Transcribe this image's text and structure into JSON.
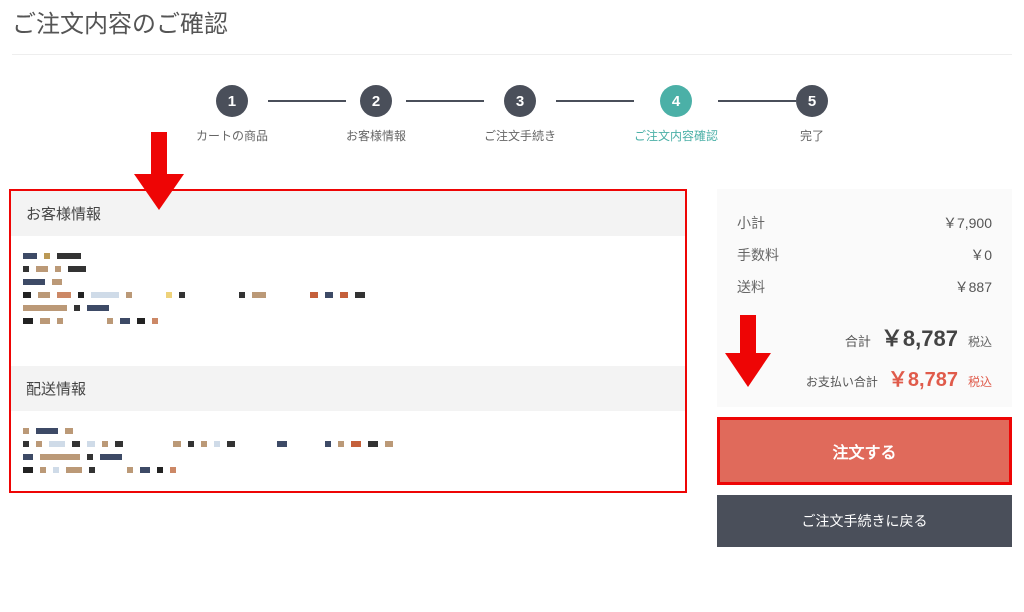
{
  "page_title": "ご注文内容のご確認",
  "stepper": [
    {
      "num": "1",
      "label": "カートの商品",
      "active": false
    },
    {
      "num": "2",
      "label": "お客様情報",
      "active": false
    },
    {
      "num": "3",
      "label": "ご注文手続き",
      "active": false
    },
    {
      "num": "4",
      "label": "ご注文内容確認",
      "active": true
    },
    {
      "num": "5",
      "label": "完了",
      "active": false
    }
  ],
  "sections": {
    "customer_heading": "お客様情報",
    "shipping_heading": "配送情報"
  },
  "summary": {
    "subtotal_label": "小計",
    "subtotal_value": "￥7,900",
    "fee_label": "手数料",
    "fee_value": "￥0",
    "shipping_label": "送料",
    "shipping_value": "￥887",
    "total_label": "合計",
    "total_value": "￥8,787",
    "tax_label": "税込",
    "pay_label": "お支払い合計",
    "pay_value": "￥8,787"
  },
  "buttons": {
    "order": "注文する",
    "back": "ご注文手続きに戻る"
  }
}
